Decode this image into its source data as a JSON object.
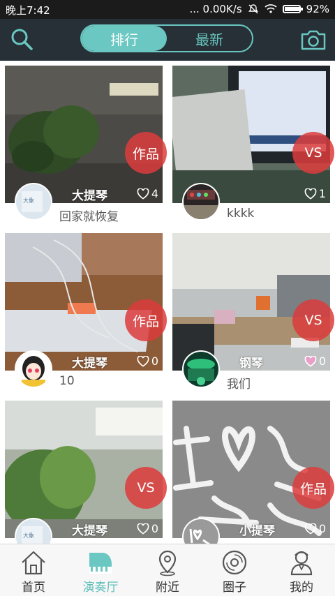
{
  "status_bar": {
    "time": "晚上7:42",
    "network": "... 0.00K/s",
    "battery": "92%",
    "battery_level": 0.92
  },
  "header": {
    "tabs": [
      {
        "label": "排行",
        "active": true
      },
      {
        "label": "最新",
        "active": false
      }
    ],
    "accent": "#6ac7c2"
  },
  "feed": [
    {
      "badge": "作品",
      "user": "大提琴",
      "likes": "4",
      "title": "回家就恢复"
    },
    {
      "badge": "VS",
      "user": "",
      "likes": "1",
      "title": "kkkk"
    },
    {
      "badge": "作品",
      "user": "大提琴",
      "likes": "0",
      "title": "10"
    },
    {
      "badge": "VS",
      "user": "钢琴",
      "likes": "0",
      "title": "我们"
    },
    {
      "badge": "VS",
      "user": "大提琴",
      "likes": "0",
      "title": ""
    },
    {
      "badge": "作品",
      "user": "小提琴",
      "likes": "0",
      "title": ""
    }
  ],
  "nav": [
    {
      "label": "首页",
      "icon": "home-icon",
      "active": false
    },
    {
      "label": "演奏厅",
      "icon": "piano-icon",
      "active": true
    },
    {
      "label": "附近",
      "icon": "location-pin-icon",
      "active": false
    },
    {
      "label": "圈子",
      "icon": "disc-icon",
      "active": false
    },
    {
      "label": "我的",
      "icon": "user-icon",
      "active": false
    }
  ]
}
